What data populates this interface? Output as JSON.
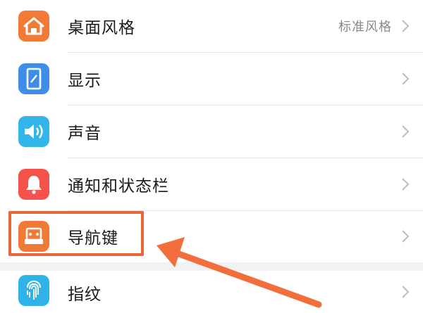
{
  "settings": {
    "items": [
      {
        "label": "桌面风格",
        "value": "标准风格",
        "icon": "home-icon",
        "color": "#f07a36"
      },
      {
        "label": "显示",
        "value": "",
        "icon": "phone-display-icon",
        "color": "#3e8ee8"
      },
      {
        "label": "声音",
        "value": "",
        "icon": "speaker-icon",
        "color": "#32b5e8"
      },
      {
        "label": "通知和状态栏",
        "value": "",
        "icon": "bell-icon",
        "color": "#f4524a"
      },
      {
        "label": "导航键",
        "value": "",
        "icon": "navigation-key-icon",
        "color": "#f07a36"
      },
      {
        "label": "指纹",
        "value": "",
        "icon": "fingerprint-icon",
        "color": "#2fb2e8"
      }
    ]
  },
  "annotation": {
    "highlight_color": "#e8663a"
  }
}
